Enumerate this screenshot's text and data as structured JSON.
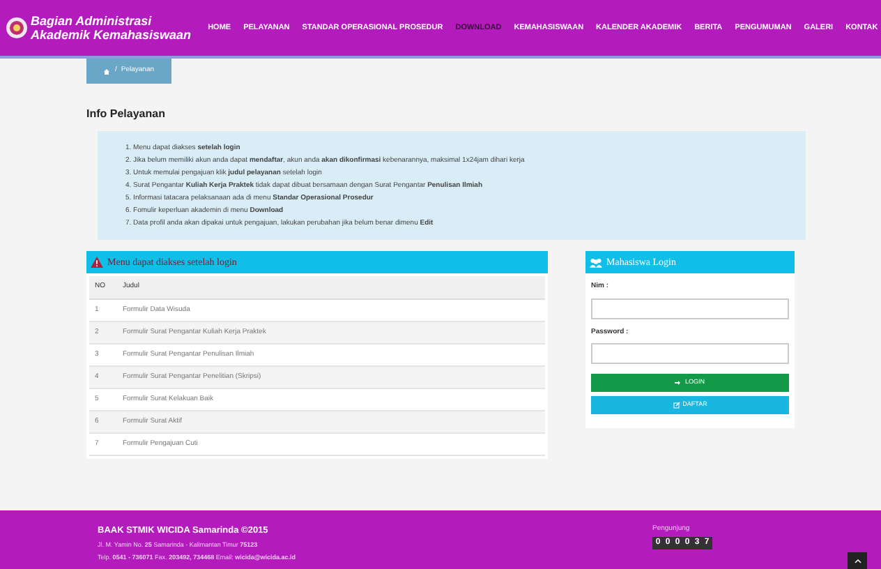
{
  "logo": {
    "line_1": "Bagian Administrasi",
    "line_2": "Akademik Kemahasiswaan"
  },
  "nav": [
    {
      "label": "HOME",
      "selected": false
    },
    {
      "label": "PELAYANAN",
      "selected": false
    },
    {
      "label": "STANDAR OPERASIONAL PROSEDUR",
      "selected": false
    },
    {
      "label": "DOWNLOAD",
      "selected": true
    },
    {
      "label": "KEMAHASISWAAN",
      "selected": false
    },
    {
      "label": "KALENDER AKADEMIK",
      "selected": false
    },
    {
      "label": "BERITA",
      "selected": false
    },
    {
      "label": "PENGUMUMAN",
      "selected": false
    },
    {
      "label": "GALERI",
      "selected": false
    },
    {
      "label": "KONTAK",
      "selected": false
    }
  ],
  "breadcrumb": {
    "separator": "/",
    "current": "Pelayanan"
  },
  "page_title": "Info Pelayanan",
  "info": [
    "1. Menu dapat diakses **setelah login**",
    "2. Jika belum memiliki akun anda dapat **mendaftar**, akun anda **akan dikonfirmasi** kebenarannya, maksimal 1x24jam dihari kerja",
    "3. Untuk memulai pengajuan klik **judul pelayanan** setelah login",
    "4. Surat Pengantar **Kuliah Kerja Praktek** tidak dapat dibuat bersamaan dengan Surat Pengantar **Penulisan Ilmiah**",
    "5. Informasi tatacara pelaksanaan ada di menu **Standar Operasional Prosedur**",
    "6. Fomulir keperluan akademin di menu **Download**",
    "7. Data profil anda akan dipakai untuk pengajuan, lakukan perubahan jika belum benar dimenu **Edit**"
  ],
  "menu_panel": {
    "title": "Menu dapat diakses setelah login",
    "table": {
      "columns": [
        "NO",
        "Judul"
      ],
      "rows": [
        [
          "1",
          "Formulir Data Wisuda"
        ],
        [
          "2",
          "Formulir Surat Pengantar Kuliah Kerja Praktek"
        ],
        [
          "3",
          "Formulir Surat Pengantar Penulisan Ilmiah"
        ],
        [
          "4",
          "Formulir Surat Pengantar Penelitian (Skripsi)"
        ],
        [
          "5",
          "Formulir Surat Kelakuan Baik"
        ],
        [
          "6",
          "Formulir Surat Aktif"
        ],
        [
          "7",
          "Formulir Pengajuan Cuti"
        ]
      ]
    }
  },
  "login_panel": {
    "title": "Mahasiswa Login",
    "fields": [
      {
        "label": "Nim :"
      },
      {
        "label": "Password :"
      }
    ],
    "buttons": [
      {
        "label": "LOGIN",
        "kind": "login"
      },
      {
        "label": "DAFTAR",
        "kind": "register"
      }
    ]
  },
  "footer": {
    "title": "BAAK STMIK WICIDA Samarinda ©2015",
    "address": "Jl. M. Yamin No. **25** Samarinda - Kalimantan Timur **75123**",
    "contact": "Telp. **0541 - 736071** Fax. **203492, 734468** Email: **wicida@wicida.ac.id**",
    "counter_label": "Pengunjung",
    "counter_digits": [
      "0",
      "0",
      "0",
      "0",
      "3",
      "7"
    ]
  }
}
